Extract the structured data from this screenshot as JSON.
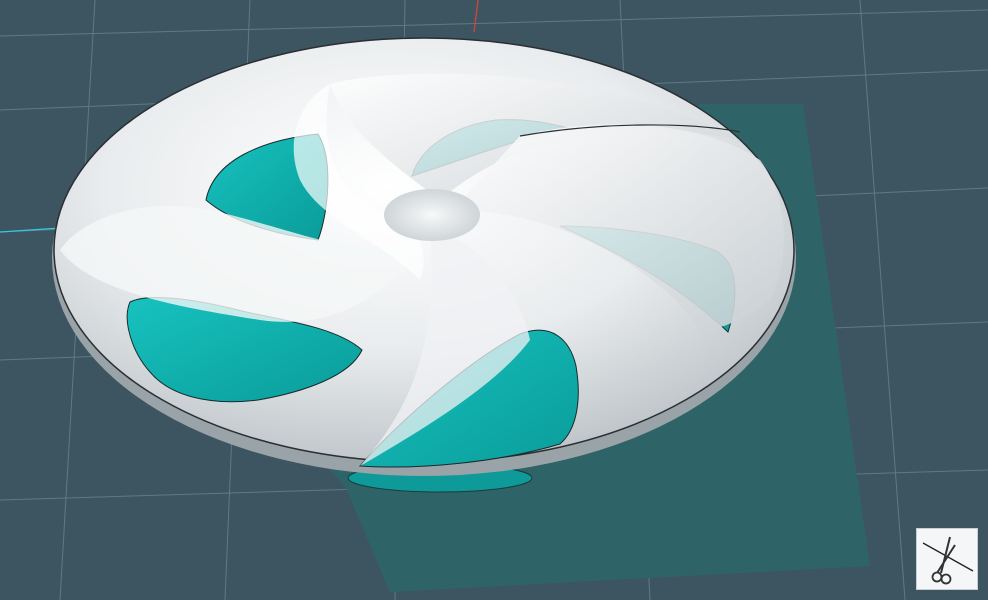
{
  "viewport": {
    "background_color": "#3d5560",
    "grid_color": "#5f7a84",
    "ground_plane_color": "#2e6468",
    "model_surface_color": "#eef0f2",
    "model_face_color": "#12b3b0"
  },
  "toolbar": {
    "tool_icon": "scissors-icon"
  }
}
